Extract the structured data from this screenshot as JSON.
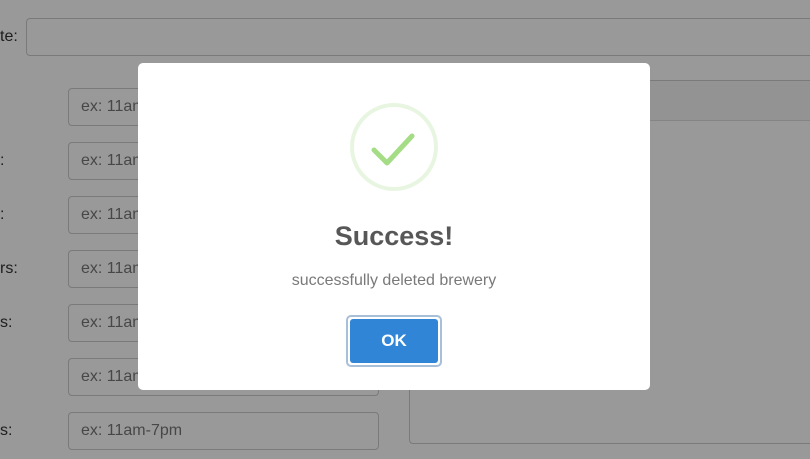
{
  "background_form": {
    "website_label": "te:",
    "labels": [
      "",
      ":",
      ":",
      "rs:",
      "s:",
      "",
      "s:"
    ],
    "placeholders": [
      "ex: 11am",
      "ex: 11am",
      "ex: 11am",
      "ex: 11am",
      "ex: 11am",
      "ex: 11am",
      "ex: 11am-7pm"
    ]
  },
  "modal": {
    "title": "Success!",
    "message": "successfully deleted brewery",
    "ok_label": "OK",
    "icon": "checkmark-icon",
    "colors": {
      "check": "#a5dc86",
      "button": "#3085d6",
      "overlay": "rgba(0,0,0,0.4)"
    }
  }
}
